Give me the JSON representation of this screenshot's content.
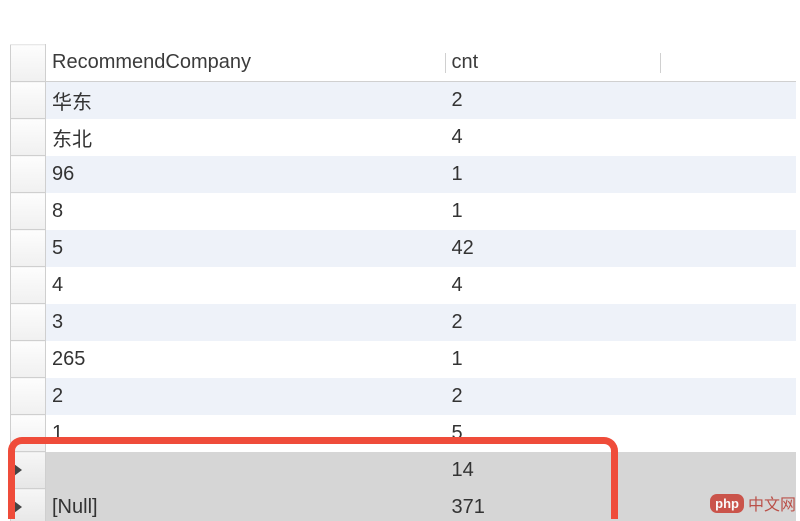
{
  "grid": {
    "columns": [
      {
        "key": "RecommendCompany",
        "label": "RecommendCompany"
      },
      {
        "key": "cnt",
        "label": "cnt"
      }
    ],
    "rows": [
      {
        "RecommendCompany": "华东",
        "cnt": "2",
        "selected": false
      },
      {
        "RecommendCompany": "东北",
        "cnt": "4",
        "selected": false
      },
      {
        "RecommendCompany": "96",
        "cnt": "1",
        "selected": false
      },
      {
        "RecommendCompany": "8",
        "cnt": "1",
        "selected": false
      },
      {
        "RecommendCompany": "5",
        "cnt": "42",
        "selected": false
      },
      {
        "RecommendCompany": "4",
        "cnt": "4",
        "selected": false
      },
      {
        "RecommendCompany": "3",
        "cnt": "2",
        "selected": false
      },
      {
        "RecommendCompany": "265",
        "cnt": "1",
        "selected": false
      },
      {
        "RecommendCompany": "2",
        "cnt": "2",
        "selected": false
      },
      {
        "RecommendCompany": "1",
        "cnt": "5",
        "selected": false
      },
      {
        "RecommendCompany": "",
        "cnt": "14",
        "selected": true
      },
      {
        "RecommendCompany": "[Null]",
        "cnt": "371",
        "selected": true
      }
    ],
    "highlighted_row_indexes": [
      10,
      11
    ]
  },
  "watermark": {
    "badge": "php",
    "text": "中文网"
  }
}
